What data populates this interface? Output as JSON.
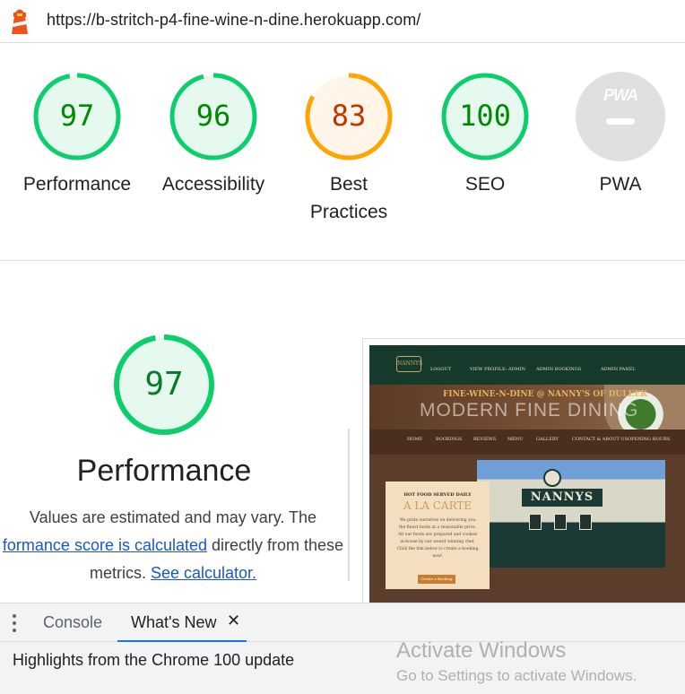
{
  "url": "https://b-stritch-p4-fine-wine-n-dine.herokuapp.com/",
  "gauges": [
    {
      "score": "97",
      "label": "Performance",
      "value": 97,
      "color": "#0cce6b",
      "text_color": "#008800",
      "bg": "#e6f9ee"
    },
    {
      "score": "96",
      "label": "Accessibility",
      "value": 96,
      "color": "#0cce6b",
      "text_color": "#008800",
      "bg": "#e6f9ee"
    },
    {
      "score": "83",
      "label_line1": "Best",
      "label_line2": "Practices",
      "value": 83,
      "color": "#ffa400",
      "text_color": "#c33300",
      "bg": "#fff6e9"
    },
    {
      "score": "100",
      "label": "SEO",
      "value": 100,
      "color": "#0cce6b",
      "text_color": "#008800",
      "bg": "#e6f9ee"
    },
    {
      "badge": "PWA",
      "label": "PWA",
      "color": "#e0e0e0"
    }
  ],
  "performance": {
    "score": "97",
    "value": 97,
    "title": "Performance",
    "desc_prefix": "Values are estimated and may vary. The",
    "link_calc": "formance score is calculated",
    "desc_mid": " directly from these",
    "desc_metrics": "metrics. ",
    "link_calculator": "See calculator."
  },
  "thumbnail": {
    "logo": "NANNYS",
    "nav": [
      "LOGOUT",
      "VIEW PROFILE: ADMIN",
      "ADMIN BOOKINGS",
      "ADMIN PANEL"
    ],
    "hero_sub": "FINE-WINE-N-DINE @ NANNY'S OF DULEEK",
    "hero_title": "MODERN FINE DINING",
    "menu": [
      "HOME",
      "BOOKINGS",
      "REVIEWS",
      "MENU",
      "GALLERY",
      "CONTACT & ABOUT US",
      "OPENING HOURS"
    ],
    "sign": "NANNYS",
    "card_small": "HOT FOOD SERVED DAILY",
    "card_title": "A LA CARTE",
    "card_body": "We pride ourselves on delivering you the finest foods at a reasonable price. All our foods are prepared and cooked in-house by our award winning chef. Click the link below to create a booking now!",
    "card_button": "Create a Booking"
  },
  "drawer": {
    "tabs": [
      "Console",
      "What's New"
    ],
    "close": "✕",
    "body_text": "Highlights from the Chrome 100 update"
  },
  "watermark": {
    "title": "Activate Windows",
    "subtitle": "Go to Settings to activate Windows."
  }
}
